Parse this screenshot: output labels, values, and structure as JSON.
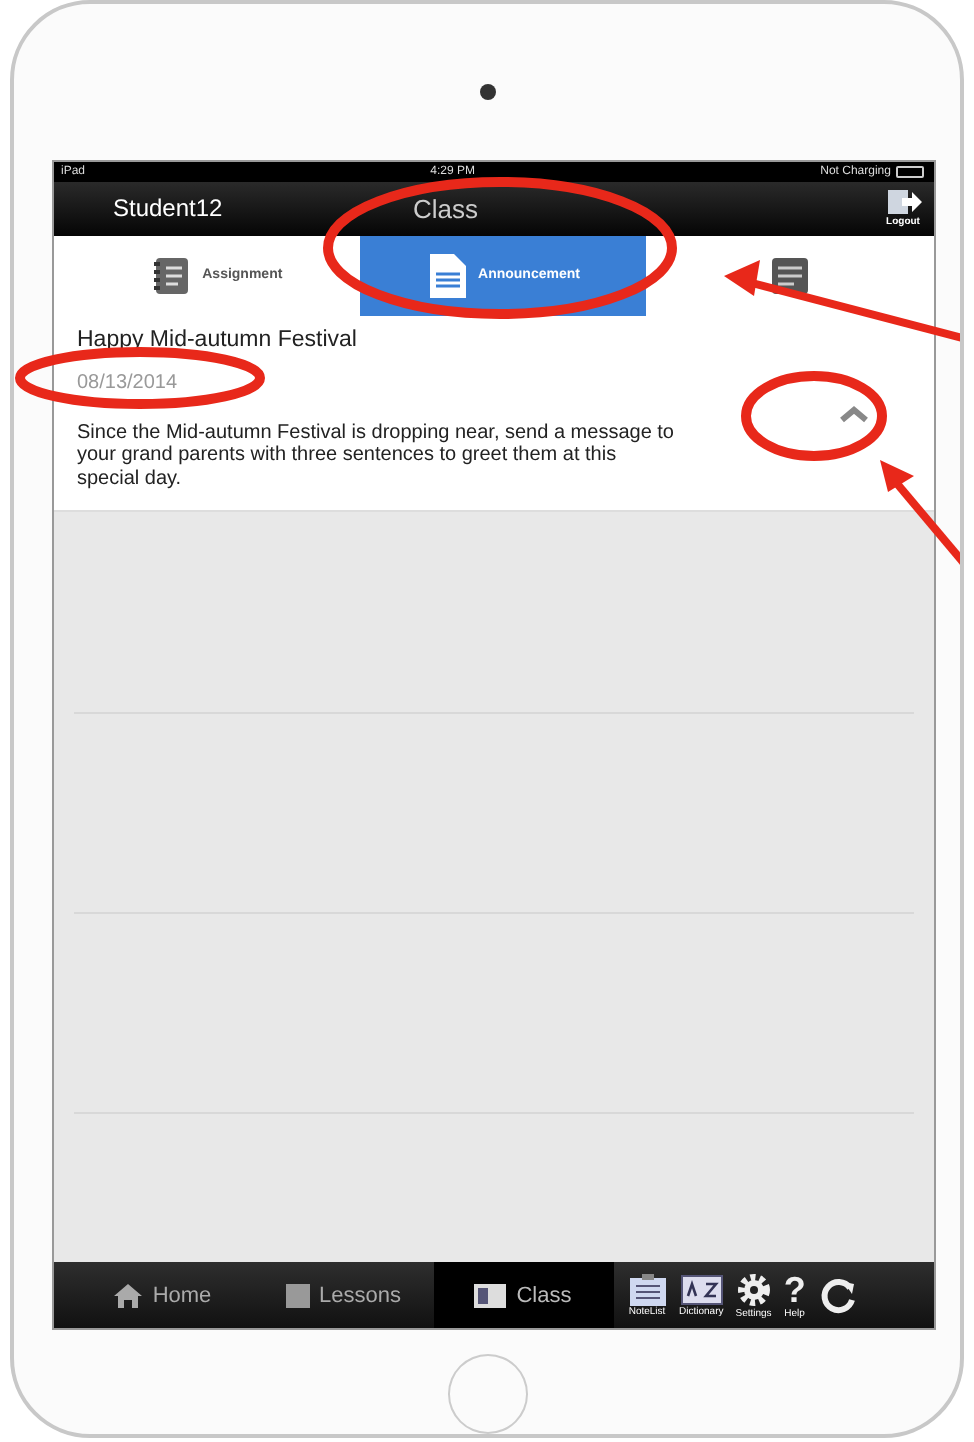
{
  "status_bar": {
    "carrier": "iPad",
    "time": "4:29 PM",
    "battery": "Not Charging"
  },
  "nav": {
    "user": "Student12",
    "title": "Class",
    "logout": "Logout"
  },
  "tabs": [
    {
      "kind": "assignment",
      "label": "Assignment",
      "selected": false
    },
    {
      "kind": "announcement",
      "label": "Announcement",
      "selected": true
    },
    {
      "kind": "report",
      "selected": false
    }
  ],
  "announcement": {
    "title": "Happy Mid-autumn Festival",
    "date": "08/13/2014",
    "expanded": true,
    "body": "Since the Mid-autumn Festival is dropping near, send a message to your grand parents with three sentences to greet them at this special day."
  },
  "tab_bar": [
    {
      "kind": "home",
      "label": "Home",
      "selected": false
    },
    {
      "kind": "lessons",
      "label": "Lessons",
      "selected": false
    },
    {
      "kind": "class",
      "label": "Class",
      "selected": true
    }
  ],
  "tools": [
    {
      "kind": "notes",
      "label": "NoteList"
    },
    {
      "kind": "dictionary",
      "label": "Dictionary"
    },
    {
      "kind": "settings",
      "label": "Settings"
    },
    {
      "kind": "help",
      "label": "Help",
      "glyph": "?"
    },
    {
      "kind": "sync"
    }
  ]
}
